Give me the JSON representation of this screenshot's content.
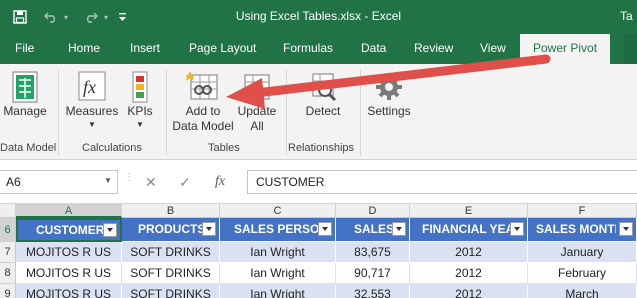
{
  "window": {
    "title": "Using Excel Tables.xlsx - Excel",
    "trailing_text": "Ta"
  },
  "tabs": [
    {
      "label": "File"
    },
    {
      "label": "Home"
    },
    {
      "label": "Insert"
    },
    {
      "label": "Page Layout"
    },
    {
      "label": "Formulas"
    },
    {
      "label": "Data"
    },
    {
      "label": "Review"
    },
    {
      "label": "View"
    },
    {
      "label": "Power Pivot",
      "active": true
    }
  ],
  "ribbon": {
    "groups": [
      {
        "label": "Data Model",
        "buttons": [
          {
            "label": "Manage",
            "icon": "manage-icon"
          }
        ]
      },
      {
        "label": "Calculations",
        "buttons": [
          {
            "label": "Measures",
            "icon": "fx-icon",
            "dropdown": true
          },
          {
            "label": "KPIs",
            "icon": "kpi-icon",
            "dropdown": true
          }
        ]
      },
      {
        "label": "Tables",
        "buttons": [
          {
            "label": "Add to Data Model",
            "line1": "Add to",
            "line2": "Data Model",
            "icon": "add-to-data-model-icon"
          },
          {
            "label": "Update All",
            "line1": "Update",
            "line2": "All",
            "icon": "update-all-icon"
          }
        ]
      },
      {
        "label": "Relationships",
        "buttons": [
          {
            "label": "Detect",
            "icon": "detect-icon"
          }
        ]
      },
      {
        "label": "",
        "buttons": [
          {
            "label": "Settings",
            "icon": "settings-icon"
          }
        ]
      }
    ]
  },
  "formula_bar": {
    "name_box": "A6",
    "fx_symbol": "fx",
    "formula": "CUSTOMER"
  },
  "sheet": {
    "columns": [
      "A",
      "B",
      "C",
      "D",
      "E",
      "F"
    ],
    "row_numbers": [
      "6",
      "7",
      "8",
      "9"
    ],
    "table_headers": [
      "CUSTOMER",
      "PRODUCTS",
      "SALES PERSON",
      "SALES",
      "FINANCIAL YEAR",
      "SALES MONTH"
    ],
    "rows": [
      [
        "MOJITOS R US",
        "SOFT DRINKS",
        "Ian Wright",
        "83,675",
        "2012",
        "January"
      ],
      [
        "MOJITOS R US",
        "SOFT DRINKS",
        "Ian Wright",
        "90,717",
        "2012",
        "February"
      ],
      [
        "MOJITOS R US",
        "SOFT DRINKS",
        "Ian Wright",
        "32,553",
        "2012",
        "March"
      ]
    ]
  },
  "colors": {
    "excel_green": "#217346",
    "table_header": "#4472c4",
    "band": "#d9e1f2",
    "arrow": "#e0504a"
  }
}
